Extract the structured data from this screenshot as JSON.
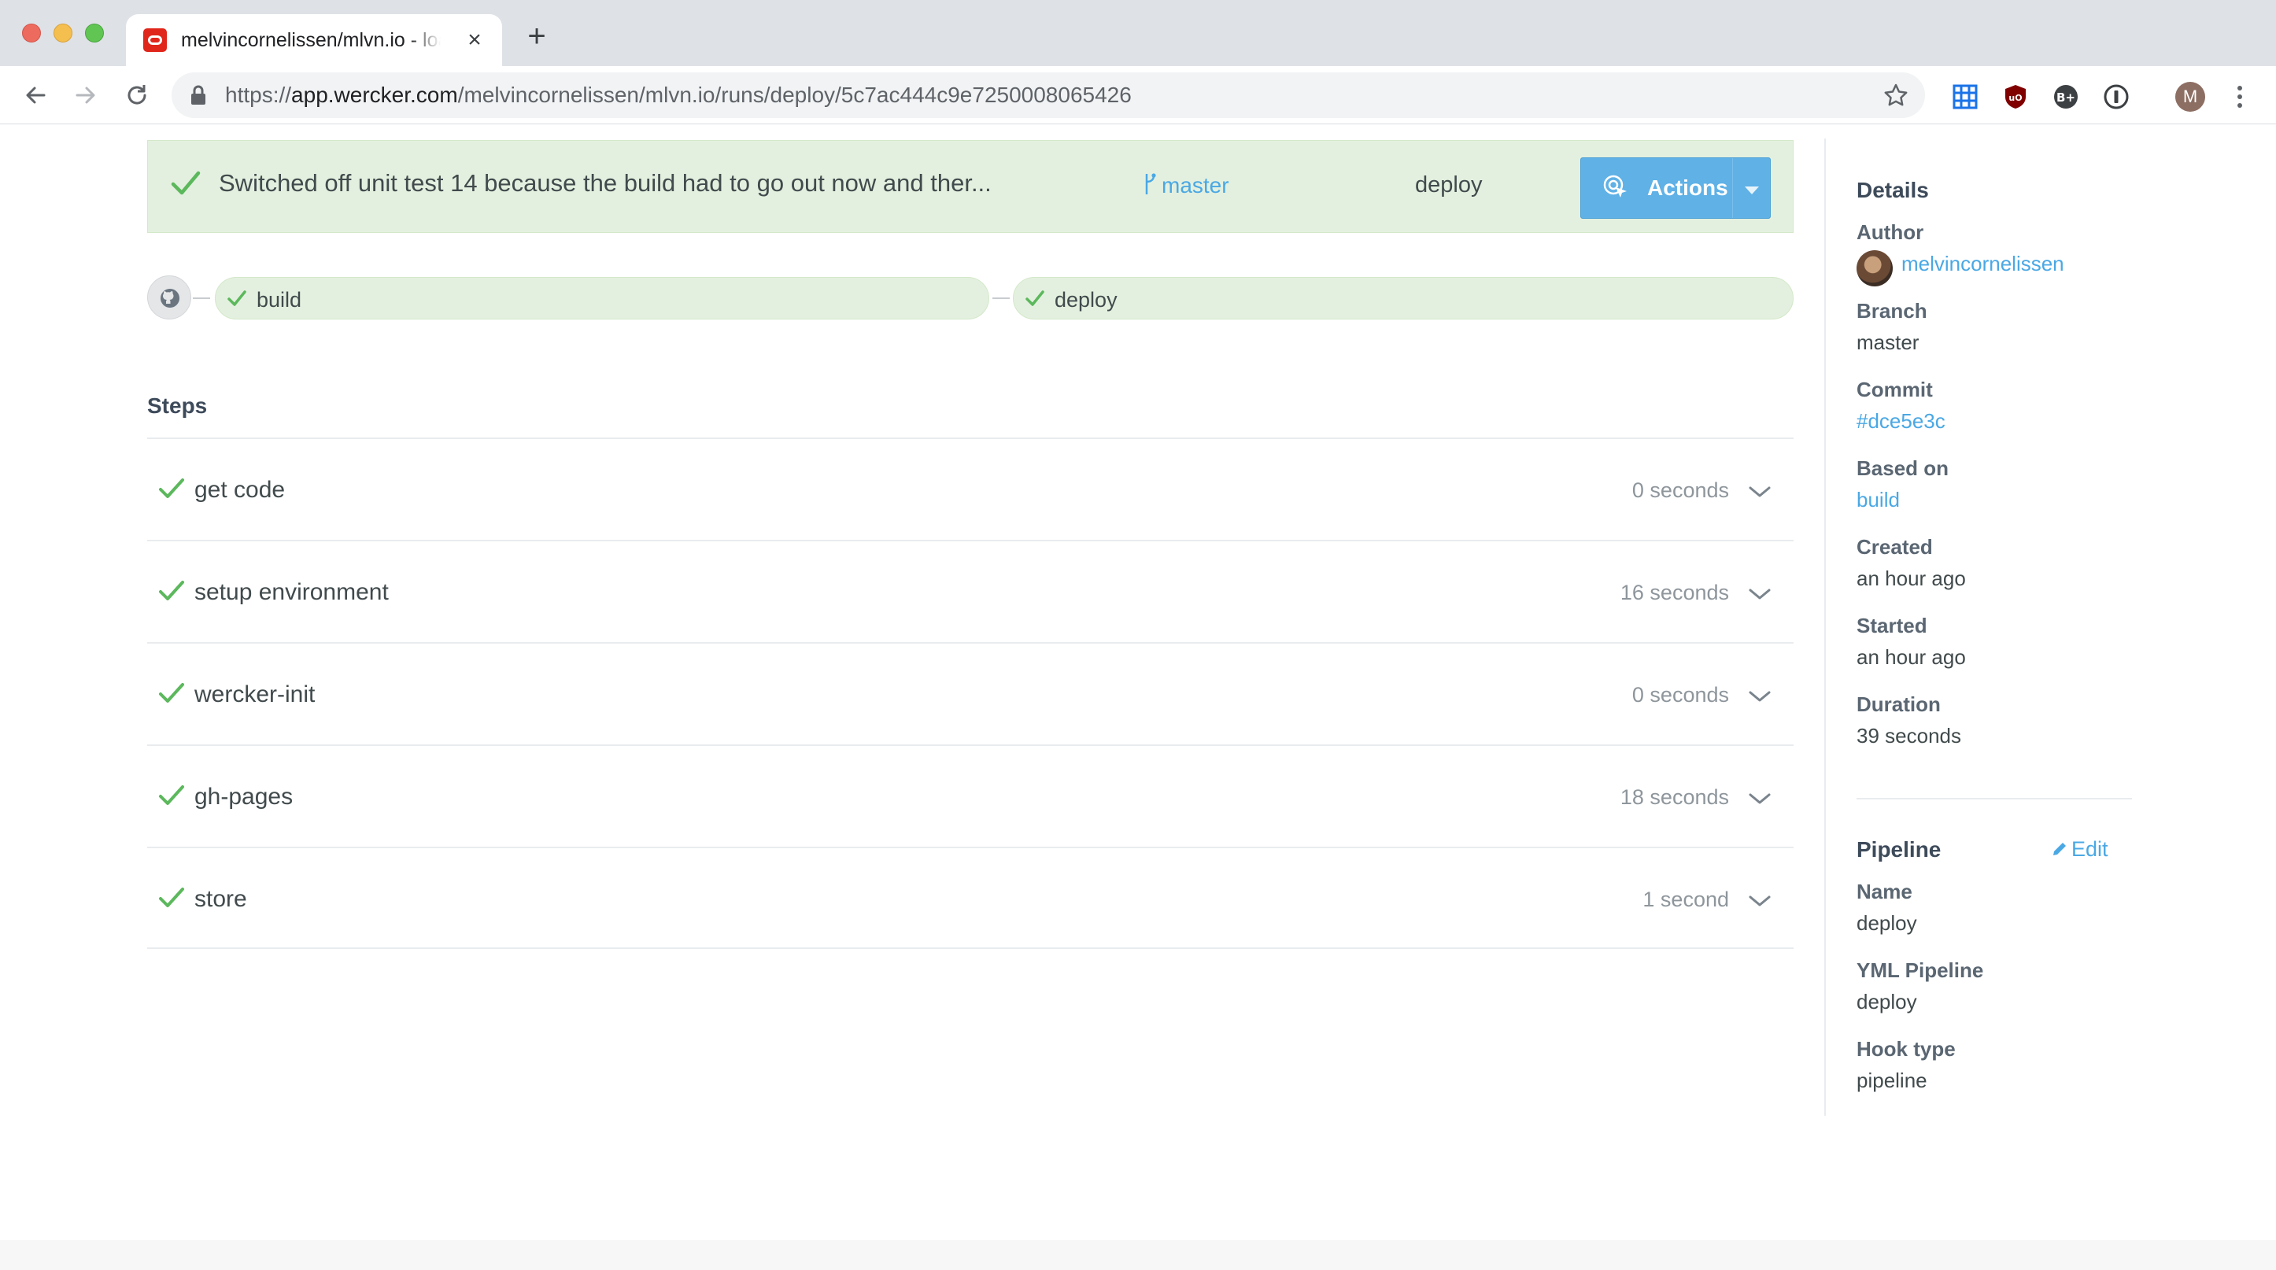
{
  "browser": {
    "tab_title": "melvincornelissen/mlvn.io - loa",
    "tab_close": "×",
    "new_tab": "+",
    "url_scheme": "https://",
    "url_host": "app.wercker.com",
    "url_path": "/melvincornelissen/mlvn.io/runs/deploy/5c7ac444c9e7250008065426",
    "profile_initial": "M"
  },
  "run": {
    "message": "Switched off unit test 14 because the build had to go out now and ther...",
    "branch": "master",
    "pipeline": "deploy",
    "actions_label": "Actions",
    "status_color": "#e4f0df",
    "accent_color": "#5fb1e6",
    "success_color": "#5cb85c"
  },
  "chain": [
    {
      "label": "build",
      "status": "passed"
    },
    {
      "label": "deploy",
      "status": "passed"
    }
  ],
  "steps": {
    "title": "Steps",
    "items": [
      {
        "name": "get code",
        "duration": "0 seconds"
      },
      {
        "name": "setup environment",
        "duration": "16 seconds"
      },
      {
        "name": "wercker-init",
        "duration": "0 seconds"
      },
      {
        "name": "gh-pages",
        "duration": "18 seconds"
      },
      {
        "name": "store",
        "duration": "1 second"
      }
    ]
  },
  "details": {
    "heading": "Details",
    "author_label": "Author",
    "author": "melvincornelissen",
    "branch_label": "Branch",
    "branch": "master",
    "commit_label": "Commit",
    "commit": "#dce5e3c",
    "based_on_label": "Based on",
    "based_on": "build",
    "created_label": "Created",
    "created": "an hour ago",
    "started_label": "Started",
    "started": "an hour ago",
    "duration_label": "Duration",
    "duration": "39 seconds"
  },
  "pipeline": {
    "heading": "Pipeline",
    "edit_label": "Edit",
    "name_label": "Name",
    "name": "deploy",
    "yml_label": "YML Pipeline",
    "yml": "deploy",
    "hook_label": "Hook type",
    "hook": "pipeline"
  }
}
